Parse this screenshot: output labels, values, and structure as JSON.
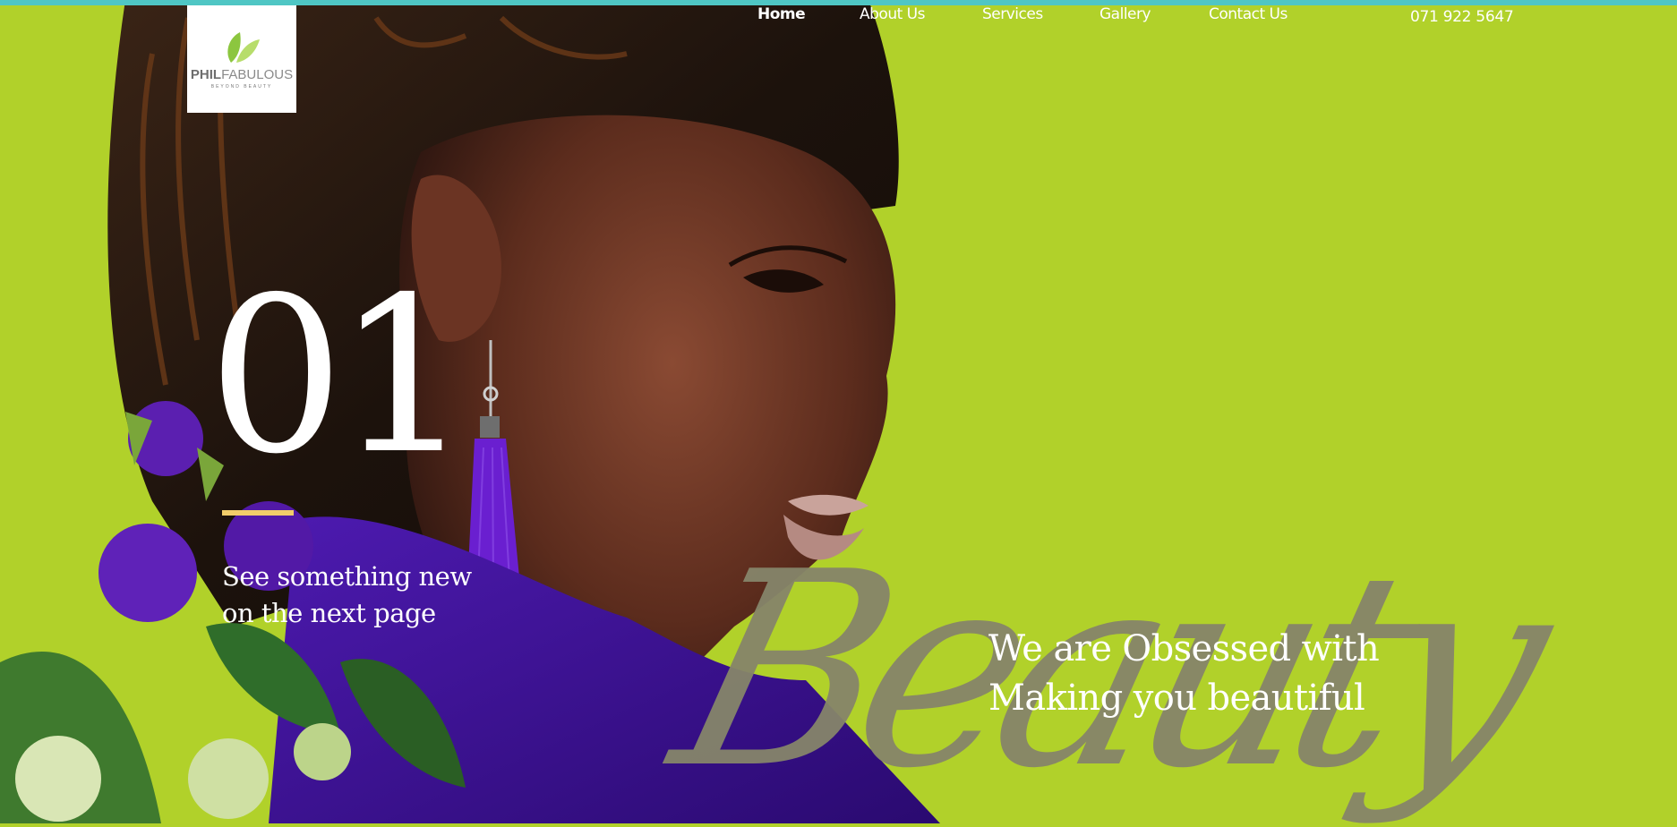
{
  "brand": {
    "name_bold": "PHIL",
    "name_light": "FABULOUS",
    "tagline": "BEYOND BEAUTY"
  },
  "nav": {
    "items": [
      {
        "label": "Home",
        "active": true
      },
      {
        "label": "About Us",
        "active": false
      },
      {
        "label": "Services",
        "active": false
      },
      {
        "label": "Gallery",
        "active": false
      },
      {
        "label": "Contact Us",
        "active": false
      }
    ],
    "phone": "071 922 5647"
  },
  "hero": {
    "slide_number": "01",
    "subtitle": "See something new on the next page",
    "script_word": "Beauty",
    "headline": "We are Obsessed with Making you beautiful"
  },
  "colors": {
    "background": "#b1d12a",
    "top_bar": "#4fc6c4",
    "accent_bar": "#f2cd6a",
    "script_text": "#86856a",
    "purple": "#5b1fb0"
  },
  "icons": {
    "logo": "leaf-icon"
  }
}
